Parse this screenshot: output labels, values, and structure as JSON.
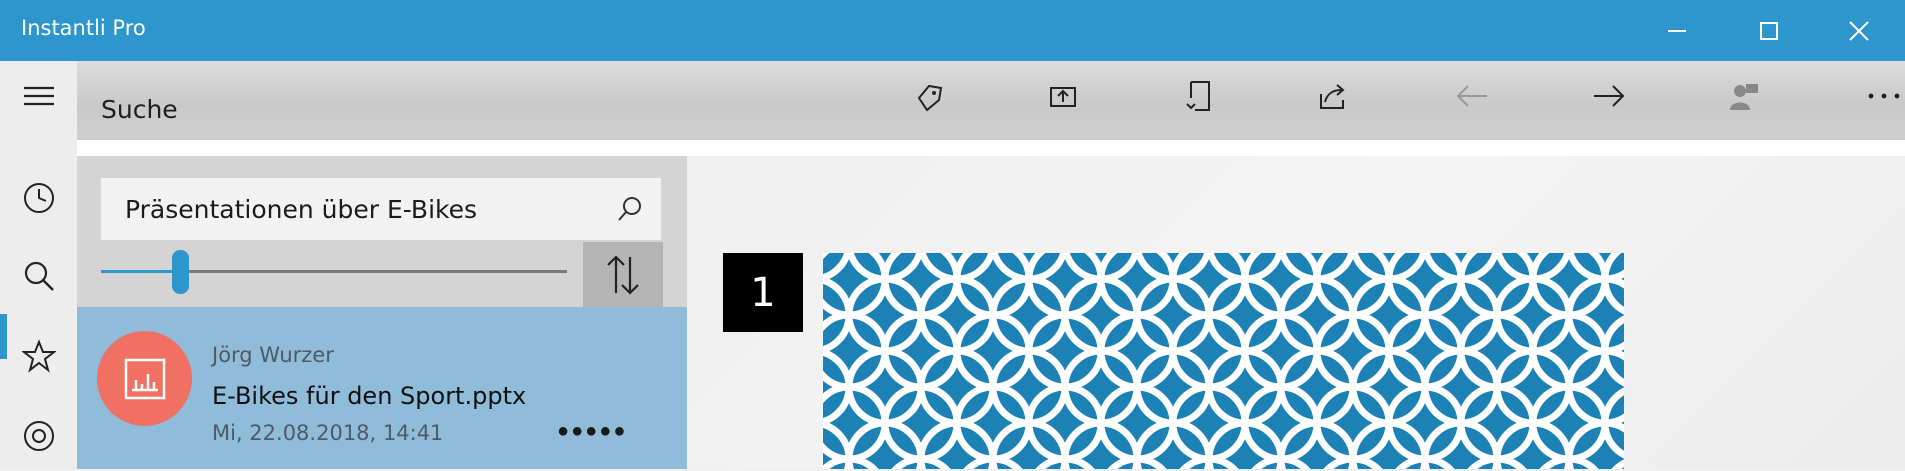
{
  "window": {
    "title": "Instantli Pro"
  },
  "toolbar": {
    "page_title": "Suche",
    "buttons": [
      {
        "name": "tag-icon"
      },
      {
        "name": "open-in-icon"
      },
      {
        "name": "document-move-icon"
      },
      {
        "name": "share-icon"
      },
      {
        "name": "back-arrow-icon",
        "enabled": false
      },
      {
        "name": "forward-arrow-icon",
        "enabled": true
      },
      {
        "name": "user-icon",
        "enabled": false
      },
      {
        "name": "more-icon"
      }
    ]
  },
  "sidebar": {
    "items": [
      {
        "name": "hamburger-menu"
      },
      {
        "name": "recent",
        "icon": "clock-icon"
      },
      {
        "name": "search",
        "icon": "search-icon",
        "active": true
      },
      {
        "name": "favorites",
        "icon": "star-icon"
      },
      {
        "name": "target",
        "icon": "target-icon"
      }
    ]
  },
  "search": {
    "value": "Präsentationen über E-Bikes",
    "slider_fraction": 0.17
  },
  "results": [
    {
      "author": "Jörg Wurzer",
      "title": "E-Bikes für den Sport.pptx",
      "date": "Mi, 22.08.2018, 14:41",
      "rating_dots": "●●●●●",
      "avatar_icon": "presentation-chart-icon"
    }
  ],
  "preview": {
    "page_number": "1"
  },
  "colors": {
    "accent": "#2c96cd",
    "selected_item": "#8fbcd9",
    "avatar": "#f07064",
    "slide_background": "#1c82b5"
  }
}
